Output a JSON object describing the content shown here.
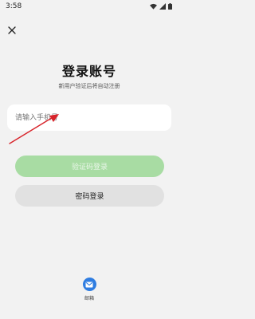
{
  "status_bar": {
    "time": "3:58",
    "icons": [
      "wifi-icon",
      "signal-icon",
      "battery-icon"
    ]
  },
  "header": {
    "close_icon": "close-icon"
  },
  "login": {
    "title": "登录账号",
    "subtitle": "新用户验证后将自动注册",
    "phone_input": {
      "placeholder": "请输入手机号",
      "value": ""
    },
    "verify_button_label": "验证码登录",
    "verify_button_enabled": false,
    "password_button_label": "密码登录"
  },
  "alt_login": {
    "email_label": "邮箱",
    "email_icon": "mail-icon"
  },
  "annotation": {
    "arrow_color": "#d8232a"
  },
  "colors": {
    "background": "#f2f2f2",
    "verify_button_bg": "#a8dca3",
    "password_button_bg": "#e1e1e1",
    "email_icon_bg": "#2f7de1"
  }
}
